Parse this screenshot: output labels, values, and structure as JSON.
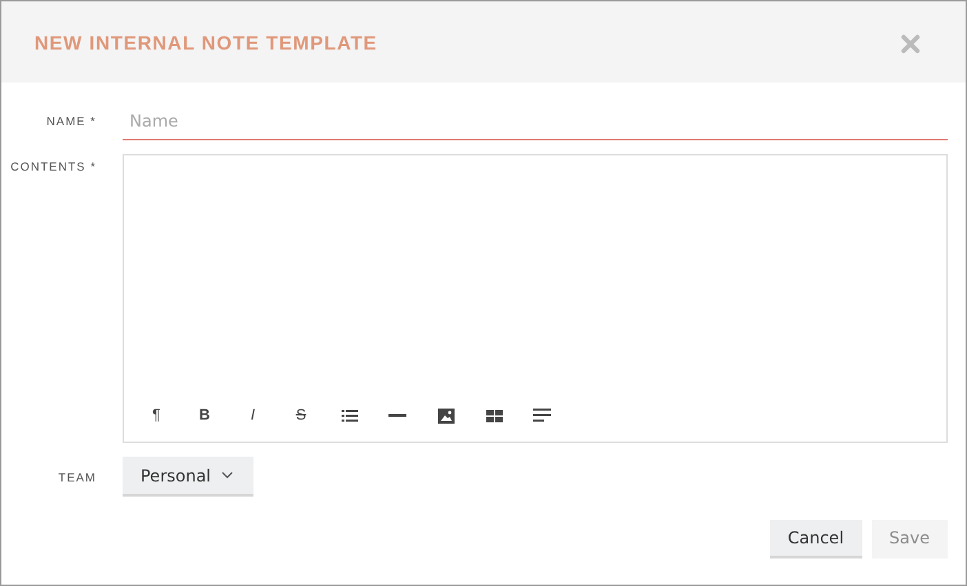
{
  "dialog": {
    "title": "NEW INTERNAL NOTE TEMPLATE"
  },
  "fields": [
    {
      "kind": "text",
      "label": "NAME *",
      "placeholder": "Name",
      "focused": true
    },
    {
      "kind": "editor",
      "label": "CONTENTS *",
      "tools": [
        {
          "kind": "paragraph",
          "label": "¶"
        },
        {
          "kind": "bold",
          "label": "B"
        },
        {
          "kind": "italic",
          "label": "I"
        },
        {
          "kind": "strike",
          "label": "S"
        },
        {
          "kind": "list"
        },
        {
          "kind": "rule"
        },
        {
          "kind": "image"
        },
        {
          "kind": "table"
        },
        {
          "kind": "align"
        }
      ]
    },
    {
      "kind": "select",
      "label": "TEAM",
      "value": "Personal"
    }
  ],
  "buttons": [
    {
      "label": "Cancel",
      "disabled": false
    },
    {
      "label": "Save",
      "disabled": true
    }
  ]
}
